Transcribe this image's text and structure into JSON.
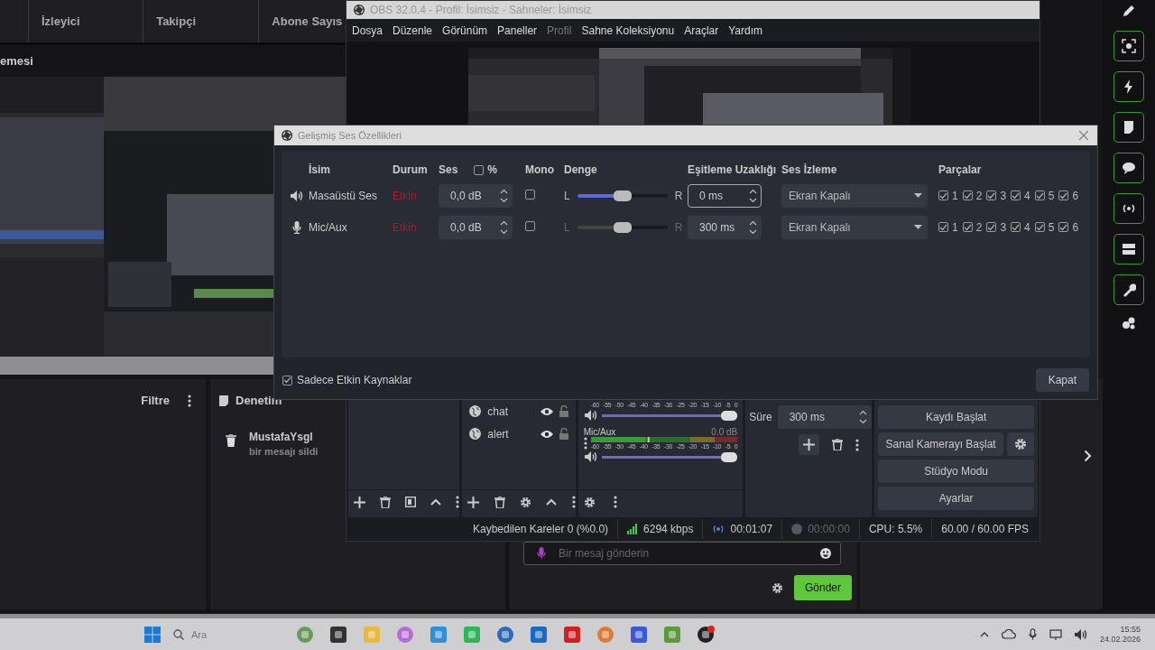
{
  "browser": {
    "stats_header": [
      "İzleyici",
      "Takipçi",
      "Abone Sayıs"
    ],
    "section_title": "emesi",
    "filter_panel": {
      "title": "Filtre"
    },
    "moderation_panel": {
      "title": "Denetim",
      "entries": [
        {
          "user": "MustafaYsgl",
          "action": "bir mesajı sildi"
        }
      ]
    },
    "chat": {
      "placeholder": "Bir mesaj gönderin",
      "send_button": "Gönder"
    }
  },
  "obs": {
    "title": "OBS 32.0.4 - Profil: İsimsiz - Sahneler: İsimsiz",
    "menu": [
      {
        "label": "Dosya",
        "disabled": false
      },
      {
        "label": "Düzenle",
        "disabled": false
      },
      {
        "label": "Görünüm",
        "disabled": false
      },
      {
        "label": "Paneller",
        "disabled": false
      },
      {
        "label": "Profil",
        "disabled": true
      },
      {
        "label": "Sahne Koleksiyonu",
        "disabled": false
      },
      {
        "label": "Araçlar",
        "disabled": false
      },
      {
        "label": "Yardım",
        "disabled": false
      }
    ],
    "sources": [
      {
        "name": "chat",
        "visible": true,
        "locked": false
      },
      {
        "name": "alert",
        "visible": true,
        "locked": false
      }
    ],
    "mixer": [
      {
        "scale": [
          "-60",
          "-55",
          "-50",
          "-45",
          "-40",
          "-35",
          "-30",
          "-25",
          "-20",
          "-15",
          "-10",
          "-5",
          "0"
        ],
        "level": 1
      },
      {
        "name": "Mic/Aux",
        "reading": "0.0 dB",
        "scale": [
          "-60",
          "-55",
          "-50",
          "-45",
          "-40",
          "-35",
          "-30",
          "-25",
          "-20",
          "-15",
          "-10",
          "-5",
          "0"
        ],
        "level": 1
      }
    ],
    "transition": {
      "label": "Süre",
      "value": "300 ms"
    },
    "controls": [
      {
        "label": "Kaydı Başlat",
        "settings": false
      },
      {
        "label": "Sanal Kamerayı Başlat",
        "settings": true
      },
      {
        "label": "Stüdyo Modu",
        "settings": false
      },
      {
        "label": "Ayarlar",
        "settings": false
      }
    ],
    "status": {
      "dropped": "Kaybedilen Kareler 0 (%0.0)",
      "bitrate": "6294 kbps",
      "stream_time": "00:01:07",
      "record_time": "00:00:00",
      "cpu": "CPU: 5.5%",
      "fps": "60.00 / 60.00 FPS"
    }
  },
  "dialog": {
    "title": "Gelişmiş Ses Özellikleri",
    "columns": [
      "İsim",
      "Durum",
      "Ses",
      "%",
      "Mono",
      "Denge",
      "Eşitleme Uzaklığı",
      "Ses İzleme",
      "Parçalar"
    ],
    "percent_checked": false,
    "rows": [
      {
        "kind": "speaker",
        "name": "Masaüstü Ses",
        "status": "Etkin",
        "volume": "0,0 dB",
        "mono": false,
        "left": "L",
        "right": "R",
        "level": 0.5,
        "focused": true,
        "sync": "0 ms",
        "monitoring": "Ekran Kapalı",
        "tracks": [
          {
            "label": "1",
            "checked": true
          },
          {
            "label": "2",
            "checked": true
          },
          {
            "label": "3",
            "checked": true
          },
          {
            "label": "4",
            "checked": true
          },
          {
            "label": "5",
            "checked": true
          },
          {
            "label": "6",
            "checked": true
          }
        ]
      },
      {
        "kind": "microphone",
        "name": "Mic/Aux",
        "status": "Etkin",
        "volume": "0,0 dB",
        "mono": false,
        "left": "L",
        "right": "R",
        "level": 0.5,
        "focused": false,
        "sync": "300 ms",
        "monitoring": "Ekran Kapalı",
        "tracks": [
          {
            "label": "1",
            "checked": true
          },
          {
            "label": "2",
            "checked": true
          },
          {
            "label": "3",
            "checked": true
          },
          {
            "label": "4",
            "checked": true
          },
          {
            "label": "5",
            "checked": true
          },
          {
            "label": "6",
            "checked": true
          }
        ]
      }
    ],
    "active_only": {
      "label": "Sadece Etkin Kaynaklar",
      "checked": true
    },
    "close_button": "Kapat"
  },
  "taskbar": {
    "search": "Ara",
    "time": "15:55",
    "date": "24.02.2026"
  }
}
